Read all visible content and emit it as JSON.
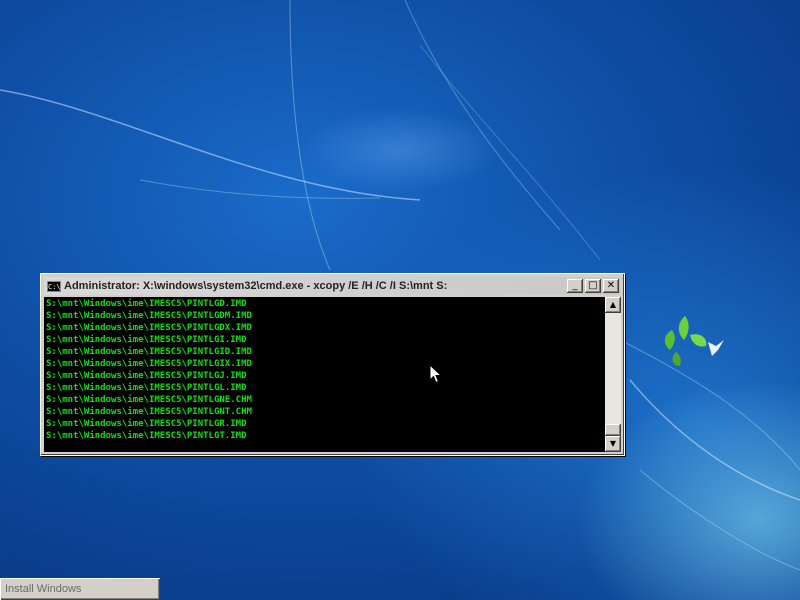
{
  "window": {
    "title": "Administrator: X:\\windows\\system32\\cmd.exe - xcopy  /E /H /C /I S:\\mnt S:",
    "icon_label": "C:\\",
    "minimize": "_",
    "maximize": "□",
    "close": "✕"
  },
  "console": {
    "lines": [
      "S:\\mnt\\Windows\\ime\\IMESC5\\PINTLGD.IMD",
      "S:\\mnt\\Windows\\ime\\IMESC5\\PINTLGDM.IMD",
      "S:\\mnt\\Windows\\ime\\IMESC5\\PINTLGDX.IMD",
      "S:\\mnt\\Windows\\ime\\IMESC5\\PINTLGI.IMD",
      "S:\\mnt\\Windows\\ime\\IMESC5\\PINTLGID.IMD",
      "S:\\mnt\\Windows\\ime\\IMESC5\\PINTLGIX.IMD",
      "S:\\mnt\\Windows\\ime\\IMESC5\\PINTLGJ.IMD",
      "S:\\mnt\\Windows\\ime\\IMESC5\\PINTLGL.IMD",
      "S:\\mnt\\Windows\\ime\\IMESC5\\PINTLGNE.CHM",
      "S:\\mnt\\Windows\\ime\\IMESC5\\PINTLGNT.CHM",
      "S:\\mnt\\Windows\\ime\\IMESC5\\PINTLGR.IMD",
      "S:\\mnt\\Windows\\ime\\IMESC5\\PINTLGT.IMD"
    ],
    "text_color": "#10e010",
    "background": "#000000"
  },
  "scrollbar": {
    "up_arrow": "▲",
    "down_arrow": "▼"
  },
  "taskbar": {
    "install_label": "Install Windows"
  },
  "icons": {
    "title_icon": "cmd-icon",
    "cursor": "mouse-pointer-icon"
  }
}
